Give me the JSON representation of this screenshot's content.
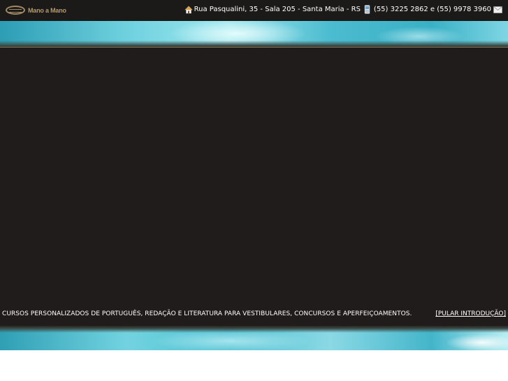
{
  "header": {
    "logo_text": "Mano a Mano",
    "address": "Rua Pasqualini, 35 - Sala 205 - Santa Maria - RS",
    "phones": "(55) 3225 2862 e (55) 9978 3960",
    "icons": [
      "home-icon",
      "phone-icon",
      "mail-icon"
    ]
  },
  "intro": {
    "tagline": "CURSOS PERSONALIZADOS DE PORTUGUÊS, REDAÇÃO E LITERATURA PARA VESTIBULARES, CONCURSOS E APERFEIÇOAMENTOS.",
    "skip_label": "[PULAR INTRODUÇÃO]"
  },
  "colors": {
    "topbar_bg": "#1c1a18",
    "stage_bg": "#201c1b",
    "logo_gold": "#b19a73",
    "band_cyan": "#4cbccf"
  }
}
